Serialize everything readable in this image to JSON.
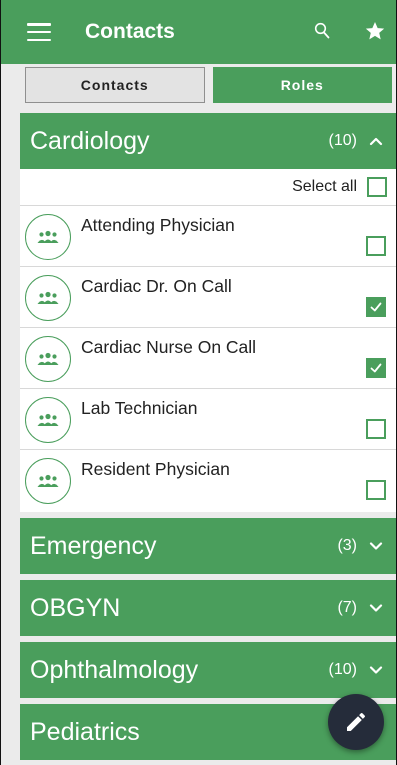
{
  "appbar": {
    "title": "Contacts",
    "menu_icon": "hamburger-menu-icon",
    "search_icon": "search-icon",
    "favorites_icon": "star-icon"
  },
  "tabs": [
    {
      "label": "Contacts",
      "selected": true
    },
    {
      "label": "Roles",
      "selected": false
    }
  ],
  "groups": {
    "cardiology": {
      "name": "Cardiology",
      "count": "(10)",
      "expanded": true,
      "select_all_label": "Select all",
      "roles": [
        {
          "name": "Attending Physician",
          "checked": false,
          "icon": "group-icon"
        },
        {
          "name": "Cardiac Dr. On Call",
          "checked": true,
          "icon": "group-icon"
        },
        {
          "name": "Cardiac Nurse On Call",
          "checked": true,
          "icon": "group-icon"
        },
        {
          "name": "Lab Technician",
          "checked": false,
          "icon": "group-icon"
        },
        {
          "name": "Resident Physician",
          "checked": false,
          "icon": "group-icon"
        }
      ]
    },
    "emergency": {
      "name": "Emergency",
      "count": "(3)",
      "expanded": false
    },
    "obgyn": {
      "name": "OBGYN",
      "count": "(7)",
      "expanded": false
    },
    "ophthalmology": {
      "name": "Ophthalmology",
      "count": "(10)",
      "expanded": false
    },
    "pediatrics": {
      "name": "Pediatrics",
      "count": "",
      "expanded": false
    }
  },
  "fab": {
    "icon": "edit-pencil-icon"
  },
  "colors": {
    "primary": "#4a9e5c",
    "fab": "#252c3a",
    "background": "#ebebeb"
  }
}
